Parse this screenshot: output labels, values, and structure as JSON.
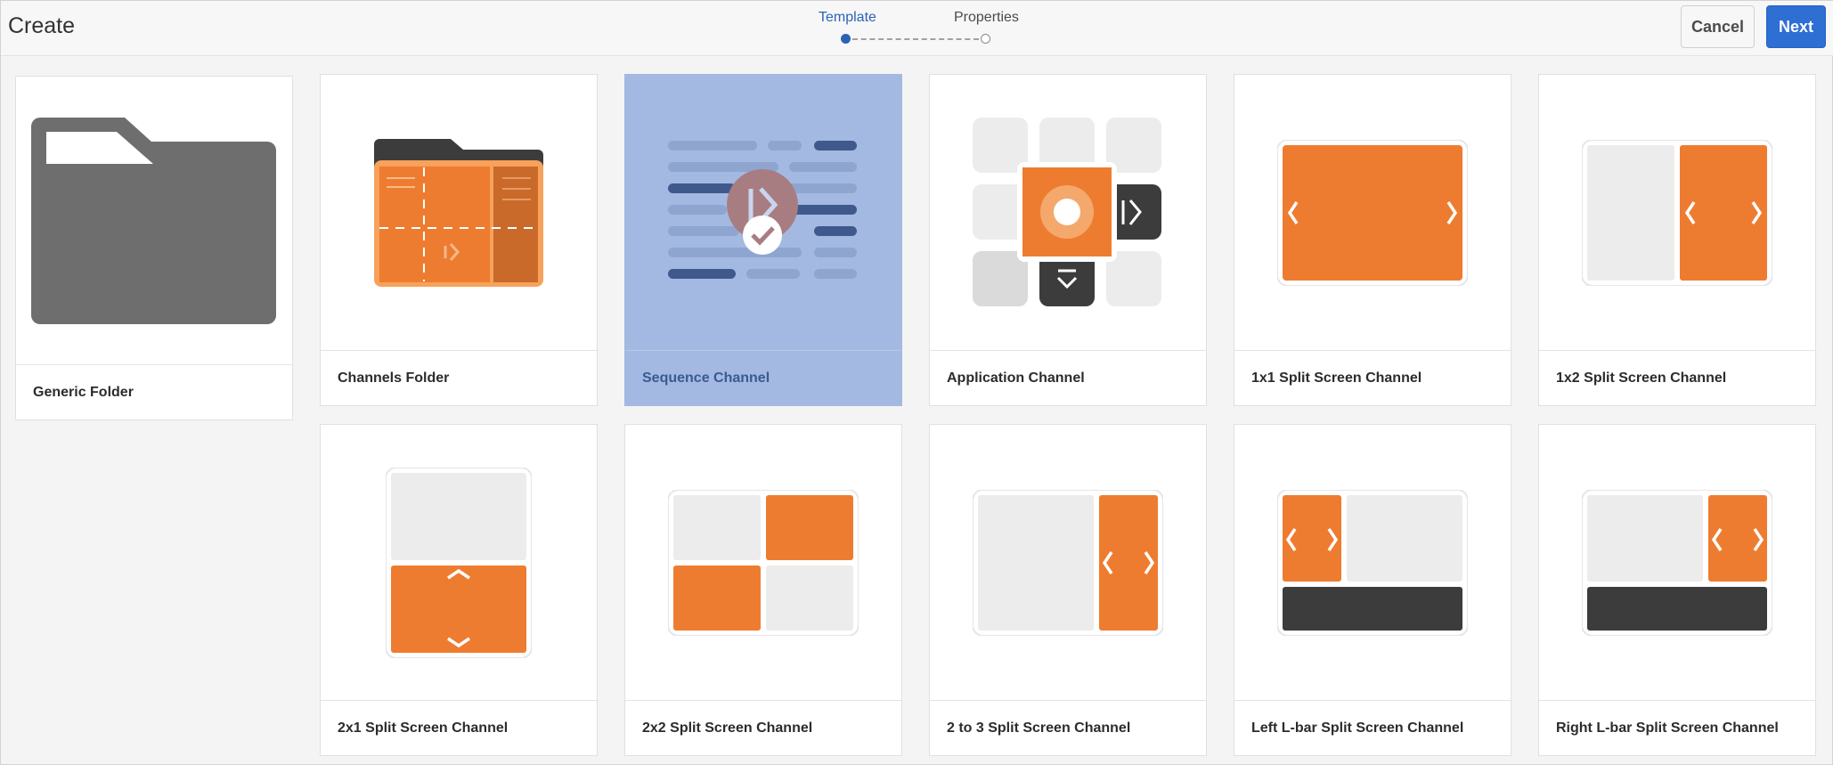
{
  "header": {
    "title": "Create",
    "steps": [
      "Template",
      "Properties"
    ],
    "active_step": 0,
    "cancel_label": "Cancel",
    "next_label": "Next"
  },
  "templates": [
    {
      "label": "Generic Folder",
      "icon": "generic-folder-icon",
      "selected": false
    },
    {
      "label": "Channels Folder",
      "icon": "channels-folder-icon",
      "selected": false
    },
    {
      "label": "Sequence Channel",
      "icon": "sequence-channel-icon",
      "selected": true
    },
    {
      "label": "Application Channel",
      "icon": "application-channel-icon",
      "selected": false
    },
    {
      "label": "1x1 Split Screen Channel",
      "icon": "split-1x1-icon",
      "selected": false
    },
    {
      "label": "1x2 Split Screen Channel",
      "icon": "split-1x2-icon",
      "selected": false
    },
    {
      "label": "2x1 Split Screen Channel",
      "icon": "split-2x1-icon",
      "selected": false
    },
    {
      "label": "2x2 Split Screen Channel",
      "icon": "split-2x2-icon",
      "selected": false
    },
    {
      "label": "2 to 3 Split Screen Channel",
      "icon": "split-2to3-icon",
      "selected": false
    },
    {
      "label": "Left L-bar Split Screen Channel",
      "icon": "left-lbar-icon",
      "selected": false
    },
    {
      "label": "Right L-bar Split Screen Channel",
      "icon": "right-lbar-icon",
      "selected": false
    }
  ],
  "colors": {
    "accent": "#2d6fd3",
    "orange": "#ee7c30",
    "dark": "#3c3c3c",
    "light_gray": "#ececec",
    "selected_bg": "#a3b9e1"
  }
}
